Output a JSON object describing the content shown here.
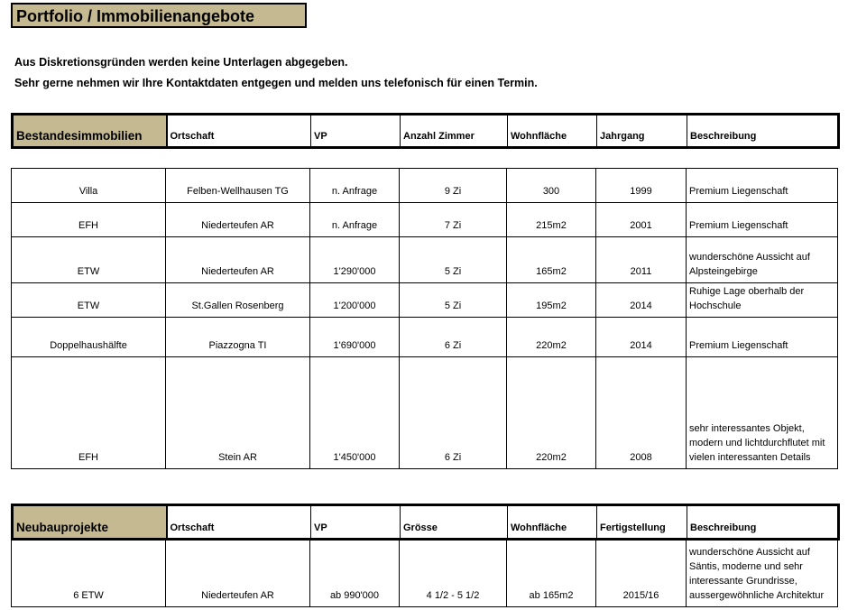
{
  "title": "Portfolio / Immobilienangebote",
  "intro": {
    "line1": "Aus Diskretionsgründen werden keine Unterlagen abgegeben.",
    "line2": "Sehr gerne nehmen wir Ihre Kontaktdaten entgegen und melden uns telefonisch für einen Termin."
  },
  "colors": {
    "section_header_bg": "#c4b991",
    "border": "#000000"
  },
  "bestand": {
    "headers": [
      "Bestandesimmobilien",
      "Ortschaft",
      "VP",
      "Anzahl Zimmer",
      "Wohnfläche",
      "Jahrgang",
      "Beschreibung"
    ],
    "rows": [
      [
        "Villa",
        "Felben-Wellhausen TG",
        "n. Anfrage",
        "9 Zi",
        "300",
        "1999",
        "Premium Liegenschaft"
      ],
      [
        "EFH",
        "Niederteufen AR",
        "n. Anfrage",
        "7 Zi",
        "215m2",
        "2001",
        "Premium Liegenschaft"
      ],
      [
        "ETW",
        "Niederteufen AR",
        "1'290'000",
        "5 Zi",
        "165m2",
        "2011",
        "wunderschöne Aussicht auf Alpsteingebirge"
      ],
      [
        "ETW",
        "St.Gallen Rosenberg",
        "1'200'000",
        "5 Zi",
        "195m2",
        "2014",
        "Ruhige Lage oberhalb der Hochschule"
      ],
      [
        "Doppelhaushälfte",
        "Piazzogna TI",
        "1'690'000",
        "6 Zi",
        "220m2",
        "2014",
        "Premium Liegenschaft"
      ],
      [
        "EFH",
        "Stein AR",
        "1'450'000",
        "6 Zi",
        "220m2",
        "2008",
        "sehr interessantes Objekt, modern und lichtdurchflutet mit vielen interessanten Details"
      ]
    ]
  },
  "neubau": {
    "headers": [
      "Neubauprojekte",
      "Ortschaft",
      "VP",
      "Grösse",
      "Wohnfläche",
      "Fertigstellung",
      "Beschreibung"
    ],
    "rows": [
      [
        "6 ETW",
        "Niederteufen AR",
        "ab 990'000",
        "4 1/2 - 5 1/2",
        "ab 165m2",
        "2015/16",
        "wunderschöne Aussicht auf Säntis, moderne und sehr interessante Grundrisse, aussergewöhnliche Architektur"
      ]
    ]
  }
}
